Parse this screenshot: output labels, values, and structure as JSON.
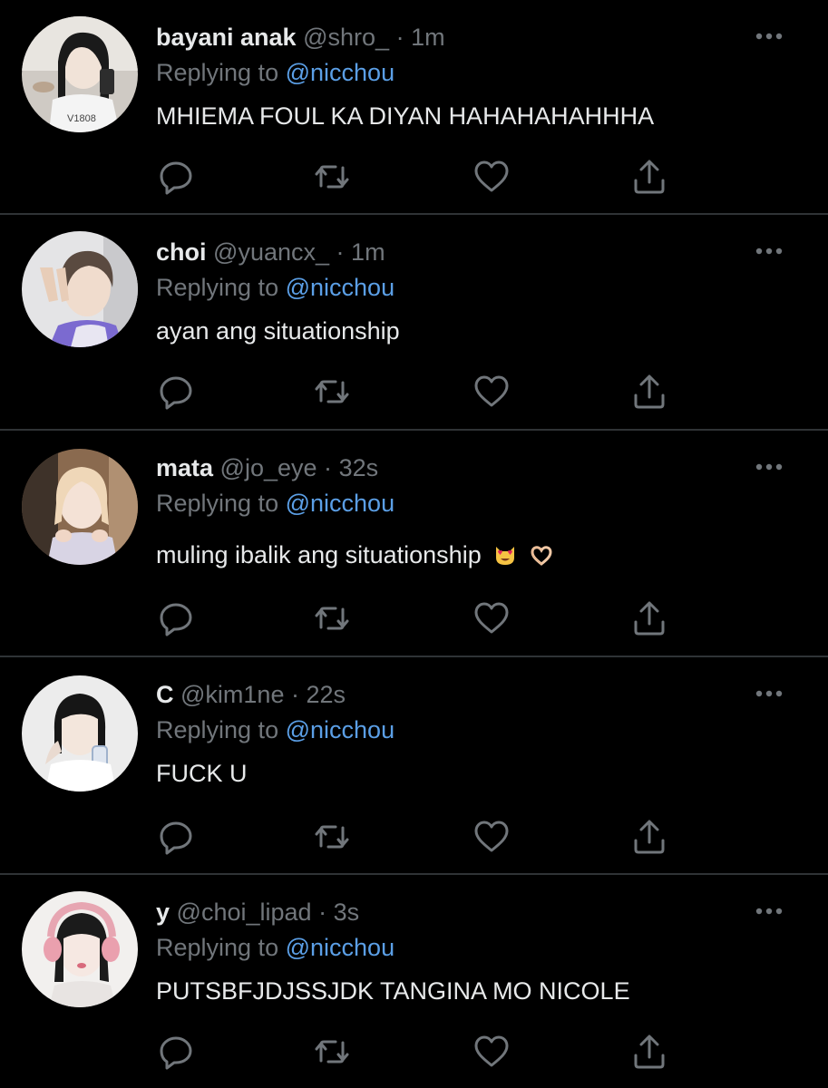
{
  "replying_prefix": "Replying to",
  "colors": {
    "background": "#000000",
    "text": "#e7e9ea",
    "secondary": "#71767b",
    "mention": "#5b9fe6",
    "divider": "#2f3336"
  },
  "tweets": [
    {
      "display_name": "bayani anak",
      "handle": "@shro_",
      "time": "1m",
      "reply_to": "@nicchou",
      "text": "MHIEMA FOUL KA DIYAN HAHAHAHAHHHA"
    },
    {
      "display_name": "choi",
      "handle": "@yuancx_",
      "time": "1m",
      "reply_to": "@nicchou",
      "text": "ayan ang situationship"
    },
    {
      "display_name": "mata",
      "handle": "@jo_eye",
      "time": "32s",
      "reply_to": "@nicchou",
      "text": "muling ibalik ang situationship",
      "emoji": [
        "heart-eyes-cat-emoji",
        "heart-hands-emoji"
      ]
    },
    {
      "display_name": "C",
      "handle": "@kim1ne",
      "time": "22s",
      "reply_to": "@nicchou",
      "text": "FUCK U"
    },
    {
      "display_name": "y",
      "handle": "@choi_lipad",
      "time": "3s",
      "reply_to": "@nicchou",
      "text": "PUTSBFJDJSSJDK TANGINA MO NICOLE"
    }
  ],
  "icons": {
    "more": "more-horizontal-icon",
    "reply": "reply-bubble-icon",
    "retweet": "retweet-icon",
    "like": "heart-icon",
    "share": "share-upload-icon"
  }
}
